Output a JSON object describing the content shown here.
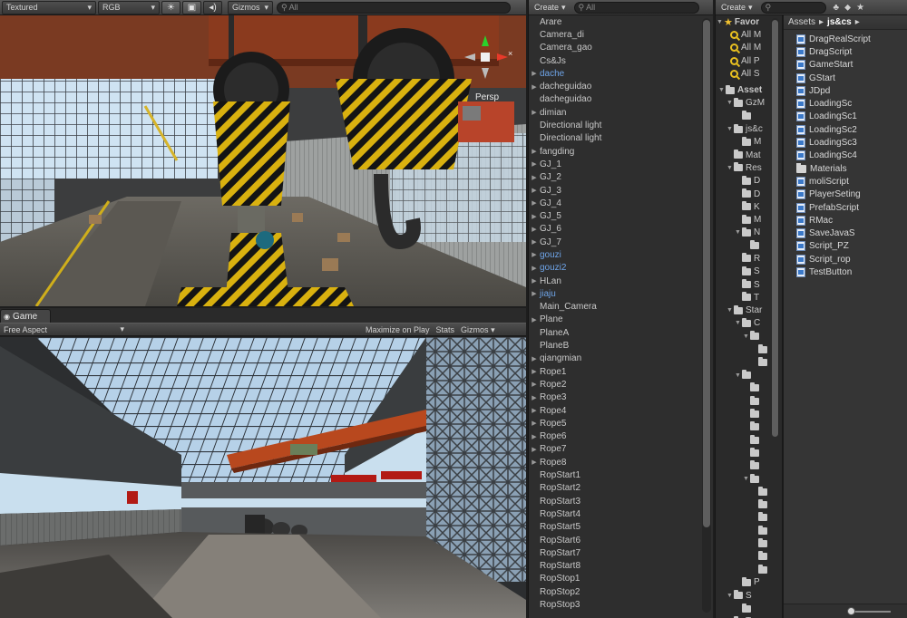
{
  "scene": {
    "draw_mode": "Textured",
    "render_mode": "RGB",
    "gizmos_label": "Gizmos",
    "search_placeholder": "All",
    "persp_label": "Persp",
    "gizmo_close": "×"
  },
  "game": {
    "tab_label": "Game",
    "aspect": "Free Aspect",
    "maximize_label": "Maximize on Play",
    "stats_label": "Stats",
    "gizmos_label": "Gizmos"
  },
  "hierarchy": {
    "create_label": "Create",
    "search_placeholder": "All",
    "items": [
      {
        "label": "Arare",
        "arrow": false,
        "prefab": false
      },
      {
        "label": "Camera_di",
        "arrow": false,
        "prefab": false
      },
      {
        "label": "Camera_gao",
        "arrow": false,
        "prefab": false
      },
      {
        "label": "Cs&Js",
        "arrow": false,
        "prefab": false
      },
      {
        "label": "dache",
        "arrow": true,
        "prefab": true
      },
      {
        "label": "dacheguidao",
        "arrow": true,
        "prefab": false
      },
      {
        "label": "dacheguidao",
        "arrow": false,
        "prefab": false
      },
      {
        "label": "dimian",
        "arrow": true,
        "prefab": false
      },
      {
        "label": "Directional light",
        "arrow": false,
        "prefab": false
      },
      {
        "label": "Directional light",
        "arrow": false,
        "prefab": false
      },
      {
        "label": "fangding",
        "arrow": true,
        "prefab": false
      },
      {
        "label": "GJ_1",
        "arrow": true,
        "prefab": false
      },
      {
        "label": "GJ_2",
        "arrow": true,
        "prefab": false
      },
      {
        "label": "GJ_3",
        "arrow": true,
        "prefab": false
      },
      {
        "label": "GJ_4",
        "arrow": true,
        "prefab": false
      },
      {
        "label": "GJ_5",
        "arrow": true,
        "prefab": false
      },
      {
        "label": "GJ_6",
        "arrow": true,
        "prefab": false
      },
      {
        "label": "GJ_7",
        "arrow": true,
        "prefab": false
      },
      {
        "label": "gouzi",
        "arrow": true,
        "prefab": true
      },
      {
        "label": "gouzi2",
        "arrow": true,
        "prefab": true
      },
      {
        "label": "HLan",
        "arrow": true,
        "prefab": false
      },
      {
        "label": "jiaju",
        "arrow": true,
        "prefab": true
      },
      {
        "label": "Main_Camera",
        "arrow": false,
        "prefab": false
      },
      {
        "label": "Plane",
        "arrow": true,
        "prefab": false
      },
      {
        "label": "PlaneA",
        "arrow": false,
        "prefab": false
      },
      {
        "label": "PlaneB",
        "arrow": false,
        "prefab": false
      },
      {
        "label": "qiangmian",
        "arrow": true,
        "prefab": false
      },
      {
        "label": "Rope1",
        "arrow": true,
        "prefab": false
      },
      {
        "label": "Rope2",
        "arrow": true,
        "prefab": false
      },
      {
        "label": "Rope3",
        "arrow": true,
        "prefab": false
      },
      {
        "label": "Rope4",
        "arrow": true,
        "prefab": false
      },
      {
        "label": "Rope5",
        "arrow": true,
        "prefab": false
      },
      {
        "label": "Rope6",
        "arrow": true,
        "prefab": false
      },
      {
        "label": "Rope7",
        "arrow": true,
        "prefab": false
      },
      {
        "label": "Rope8",
        "arrow": true,
        "prefab": false
      },
      {
        "label": "RopStart1",
        "arrow": false,
        "prefab": false
      },
      {
        "label": "RopStart2",
        "arrow": false,
        "prefab": false
      },
      {
        "label": "RopStart3",
        "arrow": false,
        "prefab": false
      },
      {
        "label": "RopStart4",
        "arrow": false,
        "prefab": false
      },
      {
        "label": "RopStart5",
        "arrow": false,
        "prefab": false
      },
      {
        "label": "RopStart6",
        "arrow": false,
        "prefab": false
      },
      {
        "label": "RopStart7",
        "arrow": false,
        "prefab": false
      },
      {
        "label": "RopStart8",
        "arrow": false,
        "prefab": false
      },
      {
        "label": "RopStop1",
        "arrow": false,
        "prefab": false
      },
      {
        "label": "RopStop2",
        "arrow": false,
        "prefab": false
      },
      {
        "label": "RopStop3",
        "arrow": false,
        "prefab": false
      }
    ]
  },
  "project": {
    "create_label": "Create",
    "breadcrumb_root": "Assets",
    "breadcrumb_current": "js&cs",
    "favorites_label": "Favor",
    "favorites": [
      "All M",
      "All M",
      "All P",
      "All S"
    ],
    "tree": [
      {
        "label": "Asset",
        "indent": 0,
        "arrow": "▼",
        "bold": true
      },
      {
        "label": "GzM",
        "indent": 1,
        "arrow": "▼",
        "bold": false
      },
      {
        "label": "",
        "indent": 2,
        "arrow": "",
        "bold": false
      },
      {
        "label": "js&c",
        "indent": 1,
        "arrow": "▼",
        "bold": false
      },
      {
        "label": "M",
        "indent": 2,
        "arrow": "",
        "bold": false
      },
      {
        "label": "Mat",
        "indent": 1,
        "arrow": "",
        "bold": false
      },
      {
        "label": "Res",
        "indent": 1,
        "arrow": "▼",
        "bold": false
      },
      {
        "label": "D",
        "indent": 2,
        "arrow": "",
        "bold": false
      },
      {
        "label": "D",
        "indent": 2,
        "arrow": "",
        "bold": false
      },
      {
        "label": "K",
        "indent": 2,
        "arrow": "",
        "bold": false
      },
      {
        "label": "M",
        "indent": 2,
        "arrow": "",
        "bold": false
      },
      {
        "label": "N",
        "indent": 2,
        "arrow": "▼",
        "bold": false
      },
      {
        "label": "",
        "indent": 3,
        "arrow": "",
        "bold": false
      },
      {
        "label": "R",
        "indent": 2,
        "arrow": "",
        "bold": false
      },
      {
        "label": "S",
        "indent": 2,
        "arrow": "",
        "bold": false
      },
      {
        "label": "S",
        "indent": 2,
        "arrow": "",
        "bold": false
      },
      {
        "label": "T",
        "indent": 2,
        "arrow": "",
        "bold": false
      },
      {
        "label": "Star",
        "indent": 1,
        "arrow": "▼",
        "bold": false
      },
      {
        "label": "C",
        "indent": 2,
        "arrow": "▼",
        "bold": false
      },
      {
        "label": "",
        "indent": 3,
        "arrow": "▼",
        "bold": false
      },
      {
        "label": "",
        "indent": 4,
        "arrow": "",
        "bold": false
      },
      {
        "label": "",
        "indent": 4,
        "arrow": "",
        "bold": false
      },
      {
        "label": "",
        "indent": 2,
        "arrow": "▼",
        "bold": false
      },
      {
        "label": "",
        "indent": 3,
        "arrow": "",
        "bold": false
      },
      {
        "label": "",
        "indent": 3,
        "arrow": "",
        "bold": false
      },
      {
        "label": "",
        "indent": 3,
        "arrow": "",
        "bold": false
      },
      {
        "label": "",
        "indent": 3,
        "arrow": "",
        "bold": false
      },
      {
        "label": "",
        "indent": 3,
        "arrow": "",
        "bold": false
      },
      {
        "label": "",
        "indent": 3,
        "arrow": "",
        "bold": false
      },
      {
        "label": "",
        "indent": 3,
        "arrow": "",
        "bold": false
      },
      {
        "label": "",
        "indent": 3,
        "arrow": "▼",
        "bold": false
      },
      {
        "label": "",
        "indent": 4,
        "arrow": "",
        "bold": false
      },
      {
        "label": "",
        "indent": 4,
        "arrow": "",
        "bold": false
      },
      {
        "label": "",
        "indent": 4,
        "arrow": "",
        "bold": false
      },
      {
        "label": "",
        "indent": 4,
        "arrow": "",
        "bold": false
      },
      {
        "label": "",
        "indent": 4,
        "arrow": "",
        "bold": false
      },
      {
        "label": "",
        "indent": 4,
        "arrow": "",
        "bold": false
      },
      {
        "label": "",
        "indent": 4,
        "arrow": "",
        "bold": false
      },
      {
        "label": "P",
        "indent": 2,
        "arrow": "",
        "bold": false
      },
      {
        "label": "S",
        "indent": 1,
        "arrow": "▼",
        "bold": false
      },
      {
        "label": "",
        "indent": 2,
        "arrow": "",
        "bold": false
      },
      {
        "label": "T",
        "indent": 1,
        "arrow": "▶",
        "bold": false
      }
    ],
    "assets": [
      {
        "label": "DragRealScript",
        "type": "script"
      },
      {
        "label": "DragScript",
        "type": "script"
      },
      {
        "label": "GameStart",
        "type": "script"
      },
      {
        "label": "GStart",
        "type": "script"
      },
      {
        "label": "JDpd",
        "type": "script"
      },
      {
        "label": "LoadingSc",
        "type": "script"
      },
      {
        "label": "LoadingSc1",
        "type": "script"
      },
      {
        "label": "LoadingSc2",
        "type": "script"
      },
      {
        "label": "LoadingSc3",
        "type": "script"
      },
      {
        "label": "LoadingSc4",
        "type": "script"
      },
      {
        "label": "Materials",
        "type": "folder"
      },
      {
        "label": "moliScript",
        "type": "script"
      },
      {
        "label": "PlayerSeting",
        "type": "script"
      },
      {
        "label": "PrefabScript",
        "type": "script"
      },
      {
        "label": "RMac",
        "type": "script"
      },
      {
        "label": "SaveJavaS",
        "type": "script"
      },
      {
        "label": "Script_PZ",
        "type": "script"
      },
      {
        "label": "Script_rop",
        "type": "script"
      },
      {
        "label": "TestButton",
        "type": "script"
      }
    ]
  }
}
